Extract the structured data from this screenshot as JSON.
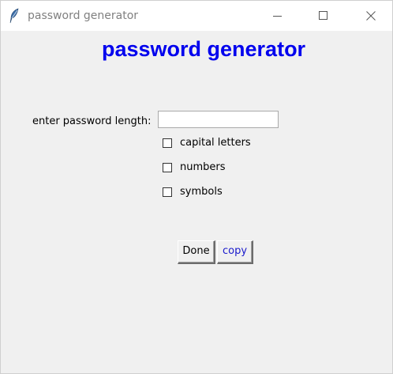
{
  "window": {
    "title": "password generator",
    "app_icon": "feather-icon",
    "controls": {
      "minimize_icon": "minimize-icon",
      "maximize_icon": "maximize-icon",
      "close_icon": "close-icon"
    }
  },
  "main": {
    "heading": "password generator",
    "heading_color": "#0000ee",
    "length_label": "enter password length:",
    "length_value": "",
    "options": [
      {
        "label": "capital letters",
        "checked": false
      },
      {
        "label": "numbers",
        "checked": false
      },
      {
        "label": "symbols",
        "checked": false
      }
    ],
    "buttons": {
      "done_label": "Done",
      "copy_label": "copy",
      "copy_color": "#1a1acc"
    }
  }
}
